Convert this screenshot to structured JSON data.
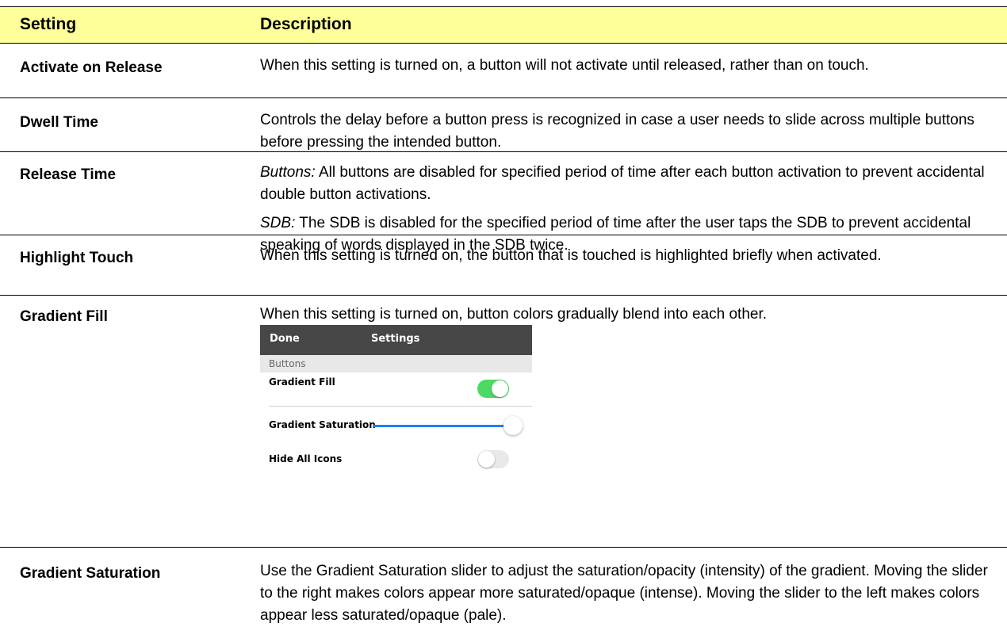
{
  "header": {
    "col_setting": "Setting",
    "col_description": "Description"
  },
  "rows": [
    {
      "name": "Activate on Release",
      "desc": "When this setting is turned on, a button will not activate until released, rather than on touch."
    },
    {
      "name": "Dwell Time",
      "desc": "Controls the delay before a button press is recognized in case a user needs to slide across multiple buttons before pressing the intended button."
    },
    {
      "name": "Release Time",
      "desc1_label": "Buttons:",
      "desc1": " All buttons are disabled for specified period of time after each button activation to prevent accidental double button activations.",
      "desc2_label": "SDB:",
      "desc2": " The SDB is disabled for the specified period of time after the user taps the SDB to prevent accidental speaking of words displayed in the SDB twice."
    },
    {
      "name": "Highlight Touch",
      "desc": "When this setting is turned on, the button that is touched is highlighted briefly when activated."
    },
    {
      "name": "Gradient Fill",
      "desc": "When this setting is turned on, button colors gradually blend into each other."
    },
    {
      "name": "Gradient Saturation",
      "desc": "Use the Gradient Saturation slider to adjust the saturation/opacity (intensity) of the gradient. Moving the slider to the right makes colors appear more saturated/opaque (intense). Moving the slider to the left makes colors appear less saturated/opaque (pale)."
    }
  ],
  "screenshot": {
    "done": "Done",
    "title": "Settings",
    "section": "Buttons",
    "gradient_fill": "Gradient Fill",
    "gradient_fill_on": true,
    "gradient_saturation": "Gradient Saturation",
    "gradient_saturation_level": 1.0,
    "hide_all_icons": "Hide All Icons",
    "hide_all_icons_on": false
  },
  "colors": {
    "header_bg": "#ffff99",
    "toggle_on": "#4cd964",
    "slider": "#1e7ef7",
    "nav_bar": "#474747"
  }
}
